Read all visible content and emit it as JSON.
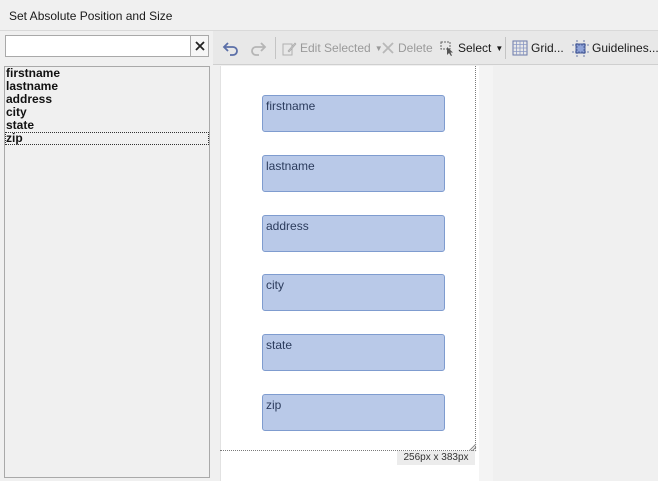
{
  "window": {
    "title": "Set Absolute Position and Size"
  },
  "search": {
    "value": "",
    "placeholder": "",
    "clear_icon": "close-icon"
  },
  "field_list": [
    {
      "label": "firstname"
    },
    {
      "label": "lastname"
    },
    {
      "label": "address"
    },
    {
      "label": "city"
    },
    {
      "label": "state"
    },
    {
      "label": "zip"
    }
  ],
  "selected_field": "zip",
  "toolbar": {
    "undo_icon": "undo-icon",
    "redo_icon": "redo-icon",
    "edit_selected_label": "Edit Selected",
    "delete_label": "Delete",
    "select_label": "Select",
    "grid_label": "Grid...",
    "guidelines_label": "Guidelines..."
  },
  "canvas": {
    "size_label": "256px x 383px",
    "fields": [
      {
        "label": "firstname"
      },
      {
        "label": "lastname"
      },
      {
        "label": "address"
      },
      {
        "label": "city"
      },
      {
        "label": "state"
      },
      {
        "label": "zip"
      }
    ]
  }
}
